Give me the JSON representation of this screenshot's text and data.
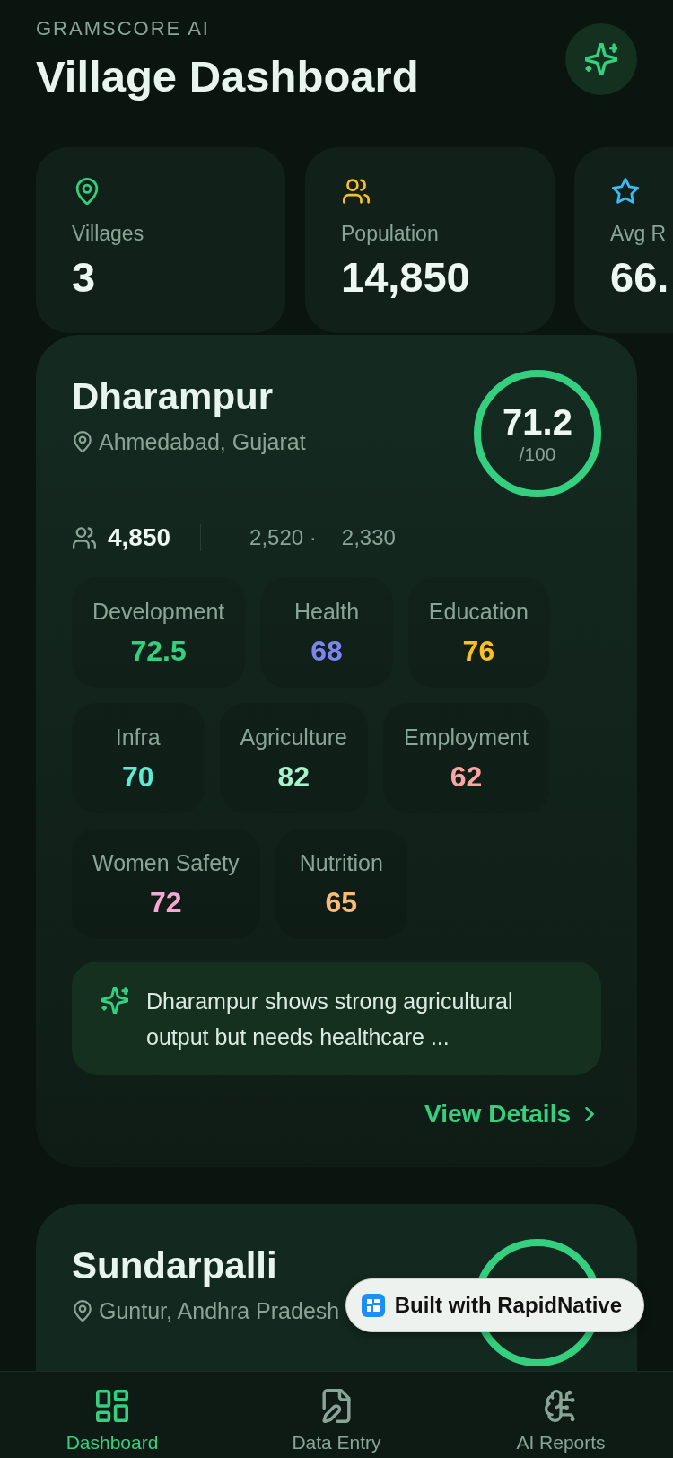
{
  "header": {
    "eyebrow": "GRAMSCORE AI",
    "title": "Village Dashboard"
  },
  "stats": [
    {
      "kind": "pin",
      "color": "#34d07f",
      "label": "Villages",
      "value": "3"
    },
    {
      "kind": "people",
      "color": "#fbbf24",
      "label": "Population",
      "value": "14,850"
    },
    {
      "kind": "star",
      "color": "#38bdf8",
      "label": "Avg R",
      "value": "66."
    }
  ],
  "villages": [
    {
      "name": "Dharampur",
      "location": "Ahmedabad, Gujarat",
      "score": "71.2",
      "score_max": "/100",
      "population": "4,850",
      "population_split": [
        "2,520 ·",
        "2,330"
      ],
      "metrics": [
        {
          "label": "Development",
          "value": "72.5",
          "color": "#34d07f"
        },
        {
          "label": "Health",
          "value": "68",
          "color": "#7c86f0"
        },
        {
          "label": "Education",
          "value": "76",
          "color": "#fbbf24"
        },
        {
          "label": "Infra",
          "value": "70",
          "color": "#5eead4"
        },
        {
          "label": "Agriculture",
          "value": "82",
          "color": "#a7f3d0"
        },
        {
          "label": "Employment",
          "value": "62",
          "color": "#fca5a5"
        },
        {
          "label": "Women Safety",
          "value": "72",
          "color": "#f9a8d4"
        },
        {
          "label": "Nutrition",
          "value": "65",
          "color": "#fdba74"
        }
      ],
      "insight": "Dharampur shows strong agricultural output but needs healthcare ...",
      "action": "View Details"
    },
    {
      "name": "Sundarpalli",
      "location": "Guntur, Andhra Pradesh"
    }
  ],
  "badge": {
    "label": "Built with RapidNative"
  },
  "tabs": [
    {
      "kind": "grid",
      "label": "Dashboard",
      "selected": true
    },
    {
      "kind": "file",
      "label": "Data Entry",
      "selected": false
    },
    {
      "kind": "brain",
      "label": "AI Reports",
      "selected": false
    }
  ]
}
